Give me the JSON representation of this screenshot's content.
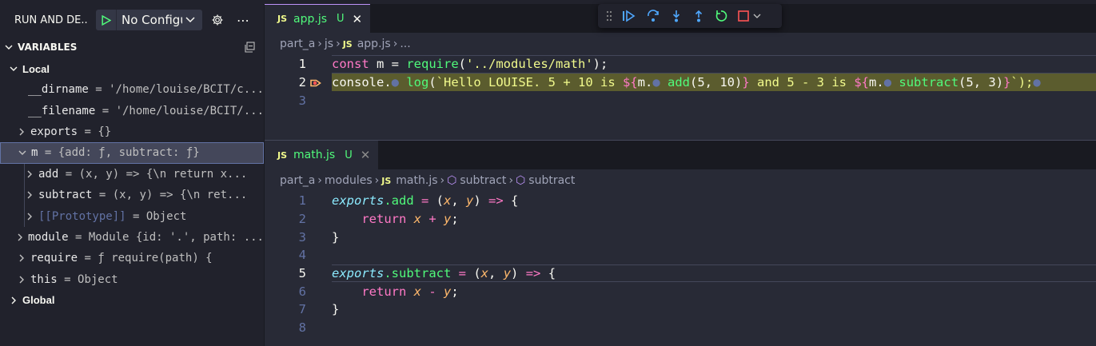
{
  "sidebar": {
    "title": "RUN AND DE...",
    "config_name": "No Configu",
    "section": "VARIABLES",
    "groups": {
      "local": "Local",
      "global": "Global"
    },
    "variables": [
      {
        "name": "__dirname",
        "value": "'/home/louise/BCIT/c...",
        "twisty": ""
      },
      {
        "name": "__filename",
        "value": "'/home/louise/BCIT/...",
        "twisty": ""
      },
      {
        "name": "exports",
        "value": "{}",
        "twisty": ">"
      },
      {
        "name": "m",
        "value": "{add: ƒ, subtract: ƒ}",
        "twisty": "v"
      },
      {
        "name": "add",
        "value": "(x, y) => {\\n    return x...",
        "twisty": ">"
      },
      {
        "name": "subtract",
        "value": "(x, y) => {\\n    ret...",
        "twisty": ">"
      },
      {
        "name": "[[Prototype]]",
        "value": "Object",
        "twisty": ">"
      },
      {
        "name": "module",
        "value": "Module {id: '.', path: ...",
        "twisty": ">"
      },
      {
        "name": "require",
        "value": "ƒ require(path) {",
        "twisty": ">"
      },
      {
        "name": "this",
        "value": "Object",
        "twisty": ">"
      }
    ]
  },
  "editor1": {
    "tab": {
      "badge": "JS",
      "name": "app.js",
      "status": "U"
    },
    "breadcrumb": [
      "part_a",
      "js",
      "app.js",
      "..."
    ],
    "lines": [
      "1",
      "2",
      "3"
    ],
    "code": {
      "l1_const": "const",
      "l1_m": " m = ",
      "l1_require": "require",
      "l1_open": "(",
      "l1_str": "'../modules/math'",
      "l1_close": ");",
      "l2_console": "console.",
      "l2_log": "log",
      "l2_open": "(",
      "l2_t1": "`Hello LOUISE. 5 + 10 is ",
      "l2_i1": "${",
      "l2_m1": "m.",
      "l2_add": "add",
      "l2_args1": "(5, 10)",
      "l2_i1c": "}",
      "l2_t2": " and 5 - 3 is ",
      "l2_i2": "${",
      "l2_m2": "m.",
      "l2_sub": "subtract",
      "l2_args2": "(5, 3)",
      "l2_i2c": "}",
      "l2_end": "`);"
    }
  },
  "editor2": {
    "tab": {
      "badge": "JS",
      "name": "math.js",
      "status": "U"
    },
    "breadcrumb": [
      "part_a",
      "modules",
      "math.js",
      "subtract",
      "subtract"
    ],
    "lines": [
      "1",
      "2",
      "3",
      "4",
      "5",
      "6",
      "7",
      "8"
    ],
    "code": {
      "exports": "exports",
      "add": ".add",
      "eq": " = ",
      "paren_open": "(",
      "x": "x",
      "comma": ", ",
      "y": "y",
      "paren_close": ")",
      "arrow": " => ",
      "brace_open": "{",
      "return": "return",
      "plus": " + ",
      "minus": " - ",
      "semi": ";",
      "brace_close": "}",
      "subtract": ".subtract"
    }
  },
  "colors": {
    "accent": "#bd93f9",
    "string": "#f1fa8c",
    "keyword": "#ff79c6",
    "function": "#50fa7b",
    "debug_line": "#5b5c2e"
  }
}
